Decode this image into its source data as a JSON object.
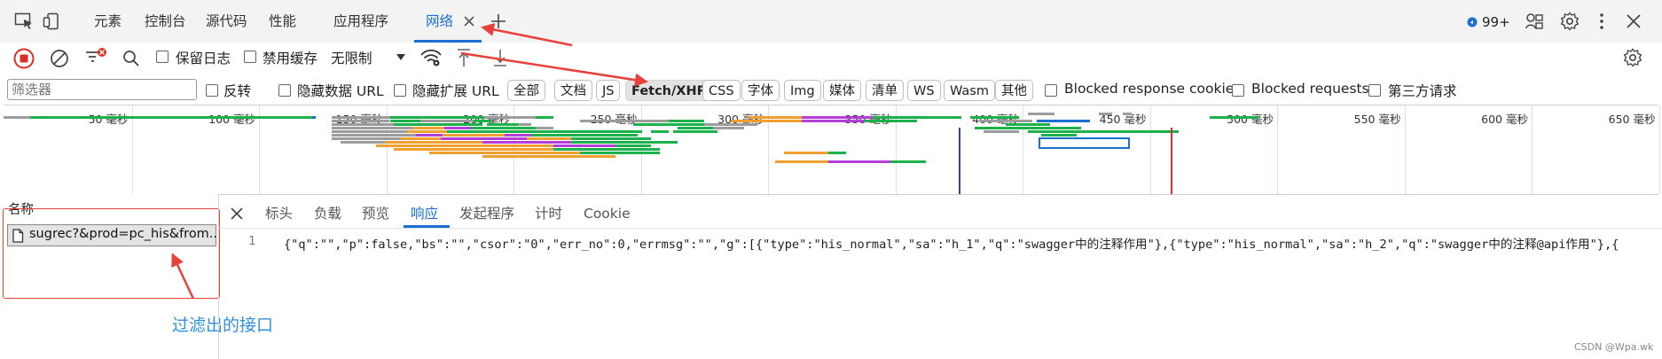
{
  "tabs": [
    {
      "label": "元素"
    },
    {
      "label": "控制台"
    },
    {
      "label": "源代码"
    },
    {
      "label": "性能"
    },
    {
      "label": "应用程序"
    },
    {
      "label": "网络"
    }
  ],
  "header": {
    "badge": "99+"
  },
  "toolbar": {
    "preserve_log": "保留日志",
    "disable_cache": "禁用缓存",
    "throttle": "无限制"
  },
  "filter": {
    "placeholder": "筛选器",
    "invert": "反转",
    "hide_data_url": "隐藏数据 URL",
    "hide_ext_url": "隐藏扩展 URL",
    "chips": [
      "全部",
      "文档",
      "JS",
      "Fetch/XHR",
      "CSS",
      "字体",
      "Img",
      "媒体",
      "清单",
      "WS",
      "Wasm",
      "其他"
    ],
    "active_chip": "Fetch/XHR",
    "blocked_cookies": "Blocked response cookies",
    "blocked_requests": "Blocked requests",
    "third_party": "第三方请求"
  },
  "overview": {
    "ticks": [
      "50 毫秒",
      "100 毫秒",
      "150 毫秒",
      "200 毫秒",
      "250 毫秒",
      "300 毫秒",
      "350 毫秒",
      "400 毫秒",
      "450 毫秒",
      "500 毫秒",
      "550 毫秒",
      "600 毫秒",
      "650 毫秒"
    ]
  },
  "requests": {
    "column_header": "名称",
    "items": [
      {
        "name": "sugrec?&prod=pc_his&from..."
      }
    ]
  },
  "detail": {
    "tabs": [
      "标头",
      "负载",
      "预览",
      "响应",
      "发起程序",
      "计时",
      "Cookie"
    ],
    "active_tab": "响应",
    "line_number": "1",
    "response_text": "{\"q\":\"\",\"p\":false,\"bs\":\"\",\"csor\":\"0\",\"err_no\":0,\"errmsg\":\"\",\"g\":[{\"type\":\"his_normal\",\"sa\":\"h_1\",\"q\":\"swagger中的注释作用\"},{\"type\":\"his_normal\",\"sa\":\"h_2\",\"q\":\"swagger中的注释@api作用\"},{"
  },
  "annotation": {
    "text": "过滤出的接口"
  },
  "watermark": "CSDN @Wpa.wk",
  "colors": {
    "accent": "#1a6fd0",
    "record": "#d93025",
    "annotation": "#e8413a",
    "xhr_bar": "#1db14b",
    "wait_bar": "#f0a030",
    "purple_bar": "#b43fd8",
    "gray_bar": "#9c9c9c"
  }
}
